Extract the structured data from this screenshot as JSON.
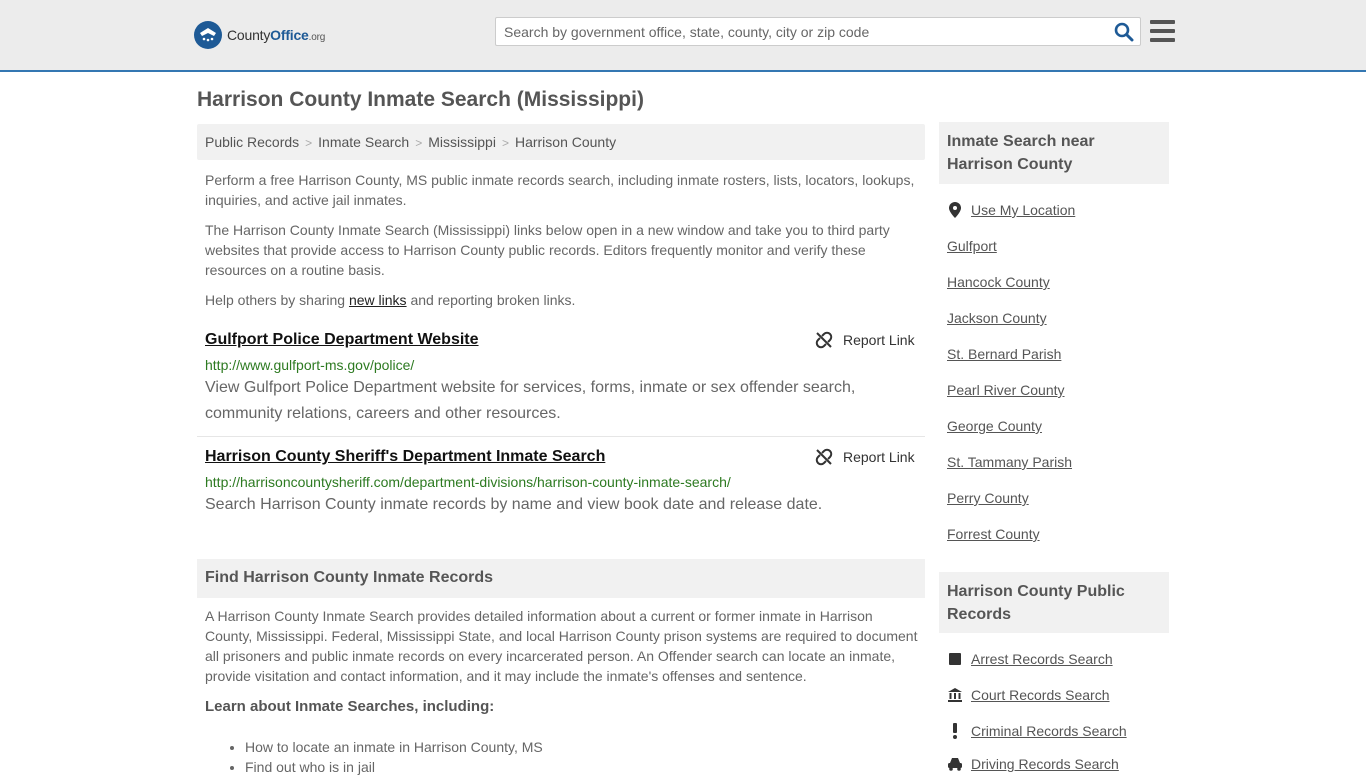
{
  "header": {
    "logo_prefix": "County",
    "logo_bold": "Office",
    "logo_suffix": ".org",
    "search_placeholder": "Search by government office, state, county, city or zip code"
  },
  "page_title": "Harrison County Inmate Search (Mississippi)",
  "breadcrumb": [
    "Public Records",
    "Inmate Search",
    "Mississippi",
    "Harrison County"
  ],
  "intro": {
    "p1": "Perform a free Harrison County, MS public inmate records search, including inmate rosters, lists, locators, lookups, inquiries, and active jail inmates.",
    "p2": "The Harrison County Inmate Search (Mississippi) links below open in a new window and take you to third party websites that provide access to Harrison County public records. Editors frequently monitor and verify these resources on a routine basis.",
    "p3_before": "Help others by sharing ",
    "p3_link": "new links",
    "p3_after": " and reporting broken links."
  },
  "results": [
    {
      "title": "Gulfport Police Department Website",
      "url": "http://www.gulfport-ms.gov/police/",
      "description": "View Gulfport Police Department website for services, forms, inmate or sex offender search, community relations, careers and other resources.",
      "report_label": "Report Link"
    },
    {
      "title": "Harrison County Sheriff's Department Inmate Search",
      "url": "http://harrisoncountysheriff.com/department-divisions/harrison-county-inmate-search/",
      "description": "Search Harrison County inmate records by name and view book date and release date.",
      "report_label": "Report Link"
    }
  ],
  "find_section": {
    "heading": "Find Harrison County Inmate Records",
    "body": "A Harrison County Inmate Search provides detailed information about a current or former inmate in Harrison County, Mississippi. Federal, Mississippi State, and local Harrison County prison systems are required to document all prisoners and public inmate records on every incarcerated person. An Offender search can locate an inmate, provide visitation and contact information, and it may include the inmate's offenses and sentence.",
    "learn_heading": "Learn about Inmate Searches, including:",
    "learn_items": [
      "How to locate an inmate in Harrison County, MS",
      "Find out who is in jail"
    ]
  },
  "sidebar": {
    "nearby_heading": "Inmate Search near Harrison County",
    "use_location": "Use My Location",
    "nearby": [
      "Gulfport",
      "Hancock County",
      "Jackson County",
      "St. Bernard Parish",
      "Pearl River County",
      "George County",
      "St. Tammany Parish",
      "Perry County",
      "Forrest County"
    ],
    "public_records_heading": "Harrison County Public Records",
    "public_records": [
      {
        "label": "Arrest Records Search",
        "icon": "square-icon"
      },
      {
        "label": "Court Records Search",
        "icon": "courthouse-icon"
      },
      {
        "label": "Criminal Records Search",
        "icon": "exclamation-icon"
      },
      {
        "label": "Driving Records Search",
        "icon": "car-icon"
      }
    ]
  }
}
